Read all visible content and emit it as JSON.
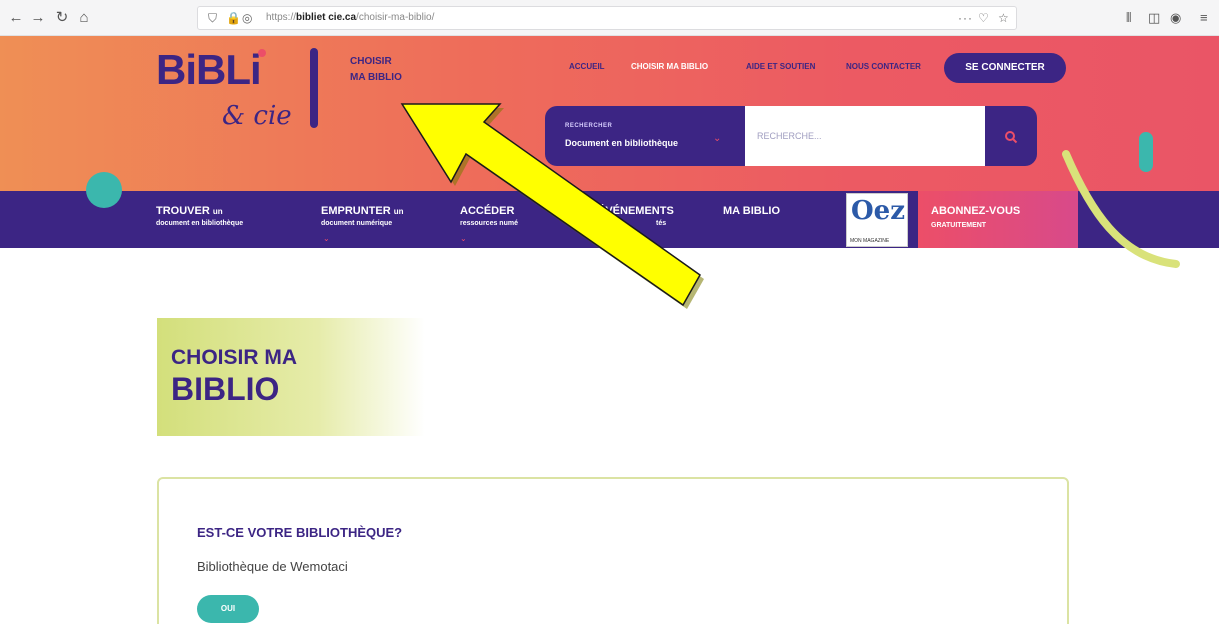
{
  "browser": {
    "url_prefix": "https://",
    "url_domain": "bibliet cie.ca",
    "url_path": "/choisir-ma-biblio/",
    "menu_dots": "···",
    "back_icon": "arrow-left-icon",
    "forward_icon": "arrow-right-icon",
    "reload_icon": "reload-icon",
    "home_icon": "home-icon"
  },
  "header": {
    "logo_main": "BiBLi",
    "logo_sub": "& cie",
    "choisir_line1": "CHOISIR",
    "choisir_line2": "MA BIBLIO",
    "topnav": [
      "ACCUEIL",
      "CHOISIR MA BIBLIO",
      "AIDE ET SOUTIEN",
      "NOUS CONTACTER"
    ],
    "connect": "SE CONNECTER"
  },
  "search": {
    "category_label": "RECHERCHER",
    "category_value": "Document en bibliothèque",
    "placeholder": "RECHERCHE..."
  },
  "mainnav": [
    {
      "title": "TROUVER",
      "title_small": "un",
      "sub": "document en bibliothèque"
    },
    {
      "title": "EMPRUNTER",
      "title_small": "un",
      "sub": "document numérique"
    },
    {
      "title": "ACCÉDER",
      "title_small": "",
      "sub": "ressources numé"
    },
    {
      "title": "ÉVÉNEMENTS",
      "title_small": "",
      "sub": "tés"
    },
    {
      "title": "MA BIBLIO",
      "title_small": "",
      "sub": ""
    }
  ],
  "magazine": {
    "letters": "Oez",
    "caption": "MON MAGAZINE"
  },
  "abonnez": {
    "title": "ABONNEZ-VOUS",
    "sub": "GRATUITEMENT"
  },
  "content": {
    "title_line1": "CHOISIR MA",
    "title_line2": "BIBLIO",
    "question": "EST-CE VOTRE BIBLIOTHÈQUE?",
    "library": "Bibliothèque de Wemotaci",
    "oui": "OUI"
  },
  "colors": {
    "brand_purple": "#3c2584",
    "brand_pink": "#ec4e68",
    "teal": "#3bb7ad",
    "lime": "#d3df7b",
    "arrow_yellow": "#ffff00"
  }
}
